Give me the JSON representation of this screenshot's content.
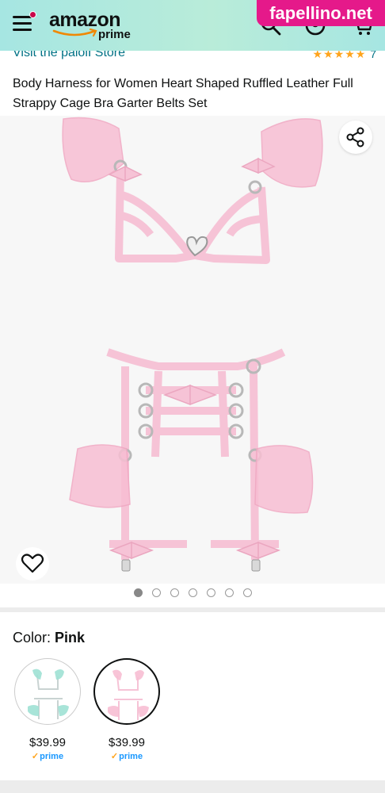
{
  "header": {
    "logo_text": "amazon",
    "logo_sub": "prime",
    "watermark": "fapellino.net"
  },
  "product": {
    "store_link": "Visit the palolI Store",
    "rating_count": "7",
    "title": "Body Harness for Women Heart Shaped Ruffled Leather Full Strappy Cage Bra Garter Belts Set",
    "gallery_total": 7,
    "gallery_index": 1
  },
  "variations": {
    "label": "Color:",
    "selected": "Pink",
    "options": [
      {
        "price": "$39.99",
        "prime": "prime",
        "color": "mint",
        "selected": false
      },
      {
        "price": "$39.99",
        "prime": "prime",
        "color": "pink",
        "selected": true
      }
    ]
  },
  "colors": {
    "header_bg": "#a6e6e2",
    "link": "#007185",
    "watermark": "#e5198a",
    "harness_pink": "#f6c3d6"
  },
  "icons": [
    "menu-icon",
    "search-icon",
    "account-icon",
    "cart-icon",
    "share-icon",
    "heart-icon",
    "prime-check-icon"
  ]
}
